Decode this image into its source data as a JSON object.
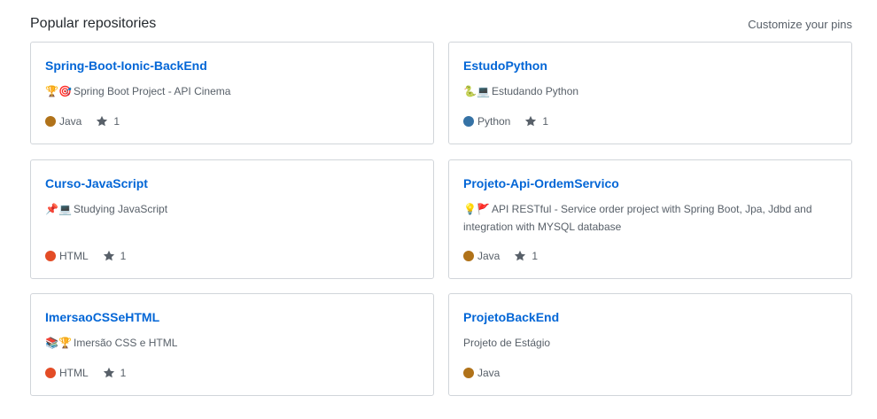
{
  "header": {
    "title": "Popular repositories",
    "customize": "Customize your pins"
  },
  "repos": [
    {
      "name": "Spring-Boot-Ionic-BackEnd",
      "emoji": "🏆🎯",
      "description": "Spring Boot Project - API Cinema",
      "language": "Java",
      "lang_color": "#b07219",
      "stars": "1"
    },
    {
      "name": "EstudoPython",
      "emoji": "🐍💻",
      "description": "Estudando Python",
      "language": "Python",
      "lang_color": "#3572A5",
      "stars": "1"
    },
    {
      "name": "Curso-JavaScript",
      "emoji": "📌💻",
      "description": "Studying JavaScript",
      "language": "HTML",
      "lang_color": "#e34c26",
      "stars": "1"
    },
    {
      "name": "Projeto-Api-OrdemServico",
      "emoji": "💡🚩",
      "description": "API RESTful - Service order project with Spring Boot, Jpa, Jdbd and integration with MYSQL database",
      "language": "Java",
      "lang_color": "#b07219",
      "stars": "1"
    },
    {
      "name": "ImersaoCSSeHTML",
      "emoji": "📚🏆",
      "description": "Imersão CSS e HTML",
      "language": "HTML",
      "lang_color": "#e34c26",
      "stars": "1"
    },
    {
      "name": "ProjetoBackEnd",
      "emoji": "",
      "description": "Projeto de Estágio",
      "language": "Java",
      "lang_color": "#b07219",
      "stars": ""
    }
  ]
}
